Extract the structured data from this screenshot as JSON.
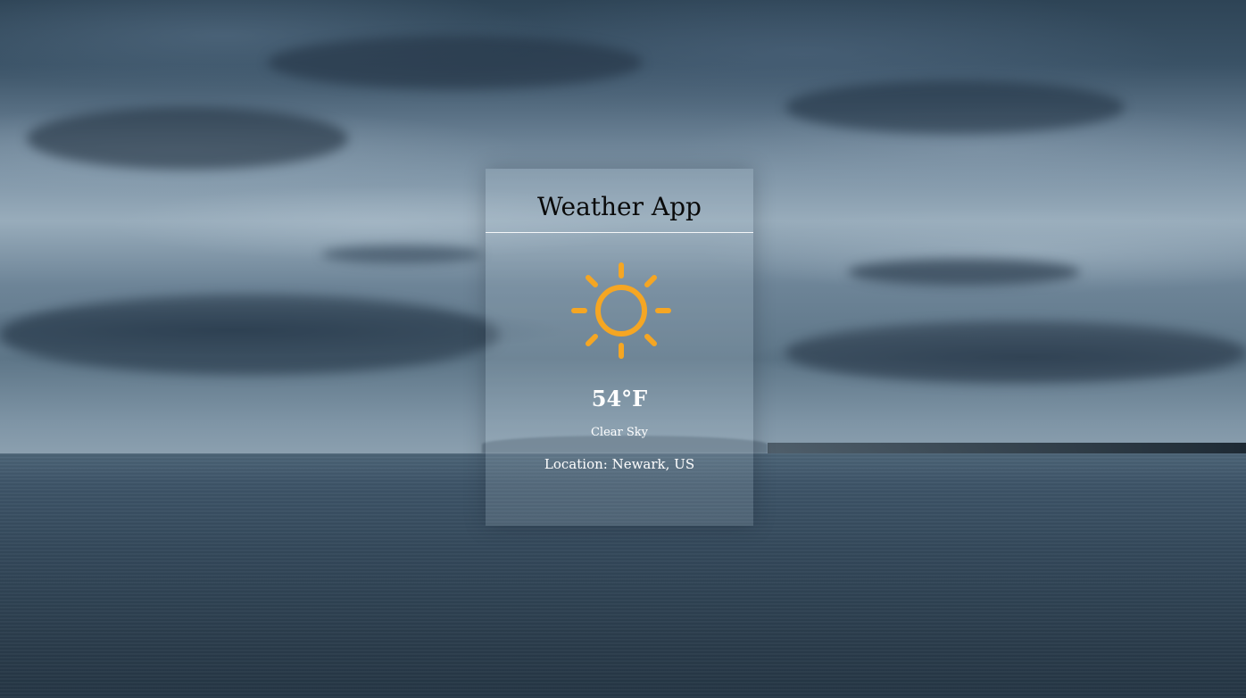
{
  "app": {
    "title": "Weather App"
  },
  "weather": {
    "icon": "sun-icon",
    "icon_color": "#F5A623",
    "temperature": "54°F",
    "condition": "Clear Sky",
    "location_label": "Location:",
    "location_value": "Newark, US"
  }
}
